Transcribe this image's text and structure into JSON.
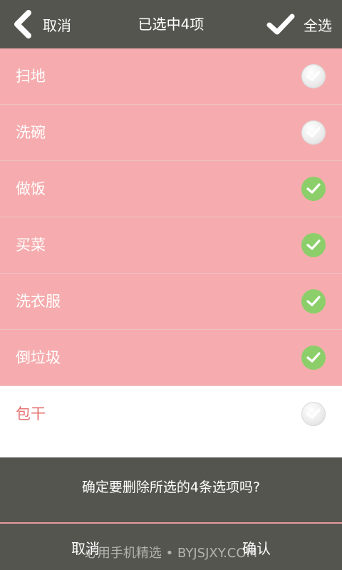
{
  "header": {
    "cancel_label": "取消",
    "title": "已选中4项",
    "select_all_label": "全选"
  },
  "items": [
    {
      "label": "扫地",
      "selected": true,
      "checked": false
    },
    {
      "label": "洗碗",
      "selected": true,
      "checked": false
    },
    {
      "label": "做饭",
      "selected": true,
      "checked": true
    },
    {
      "label": "买菜",
      "selected": true,
      "checked": true
    },
    {
      "label": "洗衣服",
      "selected": true,
      "checked": true
    },
    {
      "label": "倒垃圾",
      "selected": true,
      "checked": true
    },
    {
      "label": "包干",
      "selected": false,
      "checked": false
    }
  ],
  "dialog": {
    "message": "确定要删除所选的4条选项吗?",
    "cancel_label": "取消",
    "confirm_label": "确认"
  },
  "watermark": "必用手机精选 • BYJSJXY.COM",
  "colors": {
    "bar": "#55554f",
    "selected_row": "#f6acae",
    "check_on": "#8ccf6a",
    "unselected_text": "#e57373",
    "divider_accent": "#e39a9a"
  },
  "icons": {
    "back": "chevron-left-icon",
    "select_all": "checkmark-icon",
    "row_check": "check-circle-icon"
  }
}
